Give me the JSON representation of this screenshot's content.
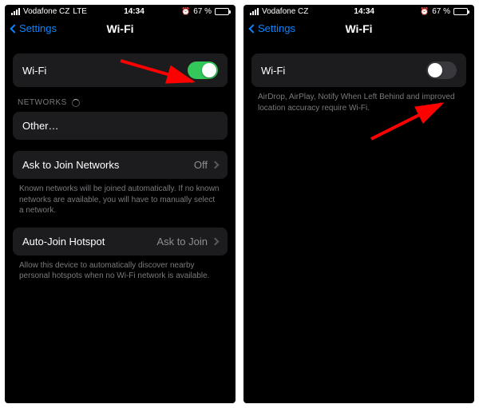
{
  "statusbar": {
    "carrier": "Vodafone CZ",
    "network": "LTE",
    "time": "14:34",
    "battery_pct": "67 %",
    "alarm_glyph": "⏰"
  },
  "nav": {
    "back_label": "Settings",
    "title": "Wi-Fi"
  },
  "left": {
    "wifi_label": "Wi-Fi",
    "networks_header": "NETWORKS",
    "other_label": "Other…",
    "ask_join_label": "Ask to Join Networks",
    "ask_join_value": "Off",
    "ask_join_footer": "Known networks will be joined automatically. If no known networks are available, you will have to manually select a network.",
    "auto_hotspot_label": "Auto-Join Hotspot",
    "auto_hotspot_value": "Ask to Join",
    "auto_hotspot_footer": "Allow this device to automatically discover nearby personal hotspots when no Wi-Fi network is available."
  },
  "right": {
    "wifi_label": "Wi-Fi",
    "wifi_off_footer": "AirDrop, AirPlay, Notify When Left Behind and improved location accuracy require Wi-Fi."
  },
  "colors": {
    "accent_blue": "#0a84ff",
    "toggle_green": "#34c759",
    "arrow_red": "#ff0000"
  }
}
